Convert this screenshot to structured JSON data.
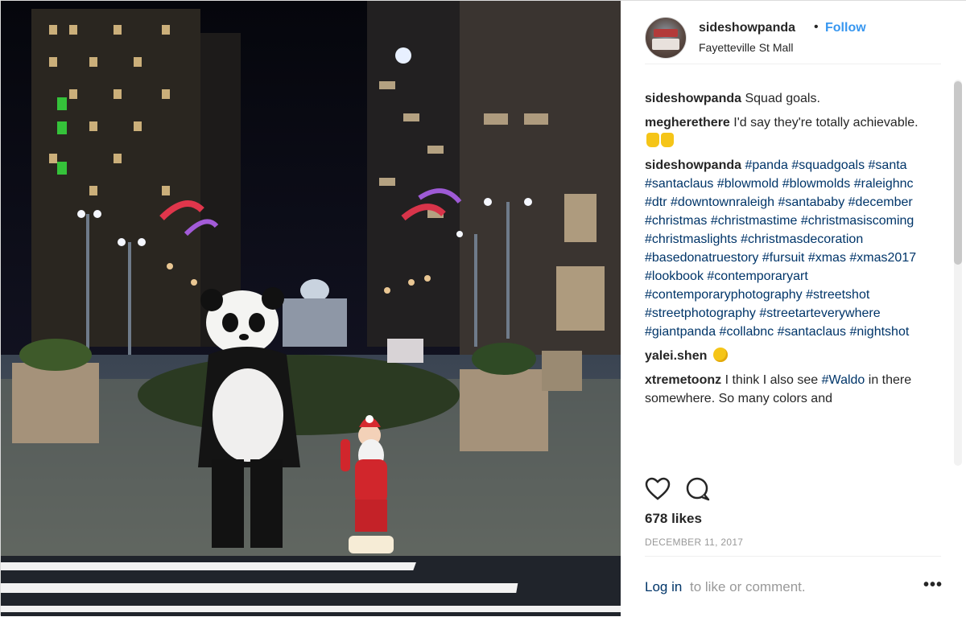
{
  "header": {
    "username": "sideshowpanda",
    "separator": "•",
    "follow_label": "Follow",
    "location": "Fayetteville St Mall"
  },
  "comments": [
    {
      "username": "sideshowpanda",
      "text": "Squad goals."
    },
    {
      "username": "megherethere",
      "text": "I'd say they're totally achievable.",
      "emoji": "thumbs-up-emoji thumbs-up-emoji"
    },
    {
      "username": "sideshowpanda",
      "hashtags": [
        "#panda",
        "#squadgoals",
        "#santa",
        "#santaclaus",
        "#blowmold",
        "#blowmolds",
        "#raleighnc",
        "#dtr",
        "#downtownraleigh",
        "#santababy",
        "#december",
        "#christmas",
        "#christmastime",
        "#christmasiscoming",
        "#christmaslights",
        "#christmasdecoration",
        "#basedonatruestory",
        "#fursuit",
        "#xmas",
        "#xmas2017",
        "#lookbook",
        "#contemporaryart",
        "#contemporaryphotography",
        "#streetshot",
        "#streetphotography",
        "#streetarteverywhere",
        "#giantpanda",
        "#collabnc",
        "#santaclaus",
        "#nightshot"
      ]
    },
    {
      "username": "yalei.shen",
      "emoji": "smiling-emoji"
    },
    {
      "username": "xtremetoonz",
      "text_before": "I think I also see",
      "tag": "#Waldo",
      "text_after": "in there somewhere. So many colors and"
    }
  ],
  "actions": {
    "like_icon": "heart-icon",
    "comment_icon": "comment-icon"
  },
  "likes": "678 likes",
  "date": "DECEMBER 11, 2017",
  "footer": {
    "login_label": "Log in",
    "rest_text": "to like or comment.",
    "more_label": "•••"
  },
  "colors": {
    "link": "#3897f0",
    "hashtag": "#003569",
    "muted": "#999999",
    "text": "#262626"
  }
}
